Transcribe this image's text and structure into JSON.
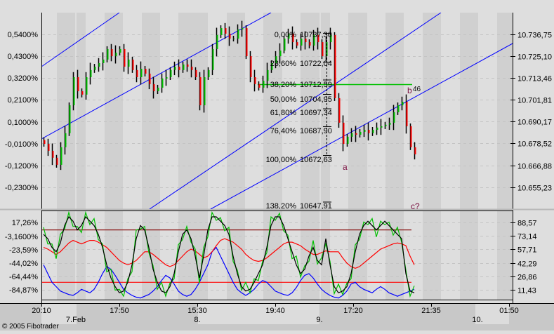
{
  "app": {
    "copyright": "© 2005 Fibotrader"
  },
  "colors": {
    "up": "#00c000",
    "down": "#ff0000",
    "channel": "#0000ff",
    "fib_line": "#00c000",
    "wave": "#7a1040"
  },
  "chart_data": {
    "type": "line",
    "title": "",
    "price_axis_right": {
      "ticks": [
        "10.736,75",
        "10.725,10",
        "10.713,46",
        "10.701,81",
        "10.690,17",
        "10.678,52",
        "10.666,88",
        "10.655,23"
      ],
      "values": [
        10736.75,
        10725.1,
        10713.46,
        10701.81,
        10690.17,
        10678.52,
        10666.88,
        10655.23
      ]
    },
    "price_axis_left": {
      "ticks": [
        "0,5400%",
        "0,4300%",
        "0,3200%",
        "0,2100%",
        "0,1000%",
        "-0,0100%",
        "-0,1200%",
        "-0,2300%"
      ]
    },
    "x_axis": {
      "time_ticks": [
        "20:10",
        "17:50",
        "15:30",
        "19:40",
        "17:20",
        "21:35",
        "01:50"
      ],
      "date_ticks": [
        "7.Feb",
        "8.",
        "9.",
        "10."
      ]
    },
    "closes": [
      10678.3,
      10674.6,
      10670.9,
      10667.1,
      10676.5,
      10684.0,
      10698.9,
      10713.9,
      10706.4,
      10704.6,
      10713.9,
      10717.7,
      10719.5,
      10721.4,
      10723.3,
      10728.9,
      10725.1,
      10727.0,
      10728.9,
      10719.5,
      10723.3,
      10717.7,
      10713.9,
      10718.4,
      10715.8,
      10710.2,
      10706.4,
      10708.3,
      10713.2,
      10713.9,
      10717.7,
      10719.5,
      10717.7,
      10720.7,
      10719.5,
      10717.7,
      10713.9,
      10698.9,
      10713.9,
      10717.7,
      10728.9,
      10736.4,
      10740.1,
      10737.1,
      10734.5,
      10734.5,
      10739.4,
      10740.1,
      10725.1,
      10713.9,
      10710.2,
      10708.3,
      10712.0,
      10717.7,
      10721.4,
      10725.1,
      10728.1,
      10734.5,
      10737.1,
      10732.6,
      10730.8,
      10734.5,
      10732.6,
      10730.8,
      10736.4,
      10732.6,
      10725.1,
      10732.6,
      10736.4,
      10702.7,
      10689.6,
      10678.3,
      10682.1,
      10684.0,
      10683.2,
      10684.7,
      10685.8,
      10684.0,
      10685.8,
      10687.0,
      10687.7,
      10688.5,
      10689.6,
      10695.2,
      10698.9,
      10700.8,
      10687.7,
      10676.5,
      10672.7
    ],
    "fibonacci": [
      {
        "pct": "0,00%",
        "value": "10737,30",
        "level": 0
      },
      {
        "pct": "23,60%",
        "value": "10722,04",
        "level": 0.236
      },
      {
        "pct": "38,20%",
        "value": "10712,59",
        "level": 0.382
      },
      {
        "pct": "50,00%",
        "value": "10704,95",
        "level": 0.5
      },
      {
        "pct": "61,80%",
        "value": "10697,34",
        "level": 0.618
      },
      {
        "pct": "76,40%",
        "value": "10687,90",
        "level": 0.764
      },
      {
        "pct": "100,00%",
        "value": "10672,63",
        "level": 1.0
      },
      {
        "pct": "138,20%",
        "value": "10647,91",
        "level": 1.382
      }
    ],
    "wave_labels": {
      "a": "a",
      "b": "b",
      "b_count": "46",
      "c": "c?"
    },
    "indicator": {
      "axis_right": {
        "ticks": [
          "88,57",
          "73,14",
          "57,71",
          "42,29",
          "26,86",
          "11,43"
        ],
        "values": [
          88.57,
          73.14,
          57.71,
          42.29,
          26.86,
          11.43
        ]
      },
      "axis_left": {
        "ticks": [
          "17,26%",
          "-3,1600%",
          "-23,59%",
          "-44,02%",
          "-64,44%",
          "-84,87%"
        ]
      },
      "levels": [
        80,
        20
      ],
      "series": [
        {
          "name": "fast",
          "color": "#00c000",
          "values": [
            83,
            64,
            64,
            47,
            75,
            81,
            100,
            84,
            84,
            77,
            100,
            86,
            93,
            69,
            64,
            32,
            35,
            11,
            12,
            4,
            24,
            32,
            80,
            81,
            84,
            54,
            39,
            12,
            20,
            4,
            19,
            24,
            63,
            69,
            84,
            66,
            58,
            19,
            60,
            72,
            100,
            91,
            94,
            79,
            83,
            44,
            34,
            11,
            20,
            8,
            24,
            22,
            44,
            54,
            95,
            91,
            99,
            79,
            74,
            47,
            50,
            26,
            39,
            44,
            68,
            41,
            48,
            64,
            44,
            7,
            18,
            6,
            19,
            24,
            63,
            69,
            89,
            86,
            93,
            72,
            90,
            86,
            89,
            74,
            83,
            66,
            34,
            4,
            16
          ]
        },
        {
          "name": "slow",
          "color": "#000000",
          "values": [
            75,
            70,
            60,
            55,
            65,
            85,
            95,
            90,
            80,
            85,
            95,
            90,
            85,
            75,
            60,
            40,
            25,
            15,
            8,
            10,
            20,
            40,
            70,
            85,
            80,
            60,
            35,
            20,
            10,
            8,
            15,
            30,
            55,
            75,
            80,
            70,
            50,
            25,
            50,
            80,
            95,
            95,
            90,
            85,
            75,
            50,
            30,
            15,
            10,
            12,
            20,
            30,
            40,
            60,
            85,
            95,
            95,
            85,
            70,
            55,
            40,
            30,
            35,
            50,
            60,
            45,
            40,
            70,
            40,
            15,
            8,
            10,
            15,
            30,
            55,
            75,
            85,
            90,
            85,
            80,
            85,
            90,
            85,
            80,
            75,
            70,
            30,
            10,
            8
          ]
        },
        {
          "name": "signal",
          "color": "#ff0000",
          "values": [
            60,
            58,
            55,
            52,
            55,
            60,
            65,
            68,
            66,
            64,
            66,
            68,
            68,
            66,
            63,
            60,
            55,
            50,
            45,
            42,
            40,
            42,
            45,
            50,
            55,
            55,
            52,
            48,
            44,
            40,
            38,
            40,
            45,
            50,
            55,
            58,
            56,
            52,
            48,
            50,
            55,
            62,
            68,
            70,
            68,
            66,
            62,
            58,
            52,
            48,
            45,
            44,
            45,
            48,
            52,
            56,
            60,
            64,
            66,
            66,
            64,
            62,
            58,
            55,
            52,
            52,
            54,
            56,
            55,
            55,
            55,
            48,
            42,
            38,
            36,
            38,
            42,
            46,
            50,
            54,
            58,
            60,
            62,
            64,
            65,
            64,
            62,
            50,
            40
          ]
        },
        {
          "name": "trend",
          "color": "#0000ff",
          "values": [
            40,
            30,
            20,
            15,
            10,
            8,
            6,
            5,
            8,
            12,
            10,
            8,
            12,
            20,
            30,
            38,
            35,
            28,
            20,
            12,
            8,
            5,
            3,
            2,
            4,
            6,
            10,
            15,
            22,
            28,
            25,
            18,
            10,
            6,
            4,
            6,
            12,
            20,
            30,
            40,
            55,
            60,
            50,
            40,
            30,
            20,
            12,
            8,
            5,
            8,
            12,
            18,
            22,
            20,
            15,
            10,
            8,
            6,
            5,
            8,
            14,
            22,
            28,
            30,
            25,
            18,
            12,
            8,
            5,
            3,
            2,
            5,
            10,
            18,
            20,
            15,
            12,
            10,
            8,
            12,
            15,
            12,
            8,
            6,
            4,
            6,
            8,
            10,
            12
          ]
        }
      ]
    }
  }
}
